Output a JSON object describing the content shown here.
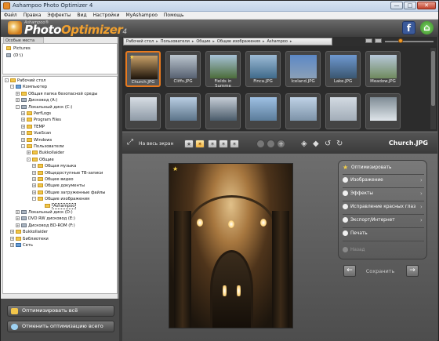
{
  "window": {
    "title": "Ashampoo Photo Optimizer 4",
    "controls": [
      "—",
      "□",
      "✕"
    ]
  },
  "menu": [
    "Файл",
    "Правка",
    "Эффекты",
    "Вид",
    "Настройки",
    "MyAshampoo",
    "Помощь"
  ],
  "header": {
    "logo_small": "Ashampoo®",
    "logo_main_a": "Photo",
    "logo_main_b": "Optimizer",
    "logo_version": "4",
    "icons": [
      "facebook-icon",
      "home-icon"
    ]
  },
  "favorites": {
    "tab_label": "Особые места",
    "items": [
      "Pictures",
      "(D:\\)"
    ]
  },
  "tree": [
    {
      "label": "Рабочий стол",
      "indent": 0,
      "icon": "folder",
      "pm": "-"
    },
    {
      "label": "Компьютер",
      "indent": 1,
      "icon": "pc",
      "pm": "-"
    },
    {
      "label": "Общая папка безопасной среды",
      "indent": 2,
      "icon": "folder",
      "pm": "+"
    },
    {
      "label": "Дисковод (A:)",
      "indent": 2,
      "icon": "drive",
      "pm": "+"
    },
    {
      "label": "Локальный диск (C:)",
      "indent": 2,
      "icon": "drive",
      "pm": "-"
    },
    {
      "label": "PerfLogs",
      "indent": 3,
      "icon": "folder",
      "pm": "+"
    },
    {
      "label": "Program Files",
      "indent": 3,
      "icon": "folder",
      "pm": "+"
    },
    {
      "label": "TEMP",
      "indent": 3,
      "icon": "folder",
      "pm": "+"
    },
    {
      "label": "VueScan",
      "indent": 3,
      "icon": "folder",
      "pm": "+"
    },
    {
      "label": "Windows",
      "indent": 3,
      "icon": "folder",
      "pm": "+"
    },
    {
      "label": "Пользователи",
      "indent": 3,
      "icon": "folder",
      "pm": "-"
    },
    {
      "label": "Bukkollaider",
      "indent": 4,
      "icon": "folder",
      "pm": "+"
    },
    {
      "label": "Общие",
      "indent": 4,
      "icon": "folder",
      "pm": "-"
    },
    {
      "label": "Общая музыка",
      "indent": 5,
      "icon": "folder",
      "pm": "+"
    },
    {
      "label": "Общедоступные ТВ-записи",
      "indent": 5,
      "icon": "folder",
      "pm": "+"
    },
    {
      "label": "Общее видео",
      "indent": 5,
      "icon": "folder",
      "pm": "+"
    },
    {
      "label": "Общие документы",
      "indent": 5,
      "icon": "folder",
      "pm": "+"
    },
    {
      "label": "Общие загруженные файлы",
      "indent": 5,
      "icon": "folder",
      "pm": "+"
    },
    {
      "label": "Общие изображения",
      "indent": 5,
      "icon": "folder",
      "pm": "-"
    },
    {
      "label": "Ashampoo",
      "indent": 6,
      "icon": "folder",
      "pm": "",
      "selected": true
    },
    {
      "label": "Локальный диск (D:)",
      "indent": 2,
      "icon": "drive",
      "pm": "+"
    },
    {
      "label": "DVD RW дисковод (E:)",
      "indent": 2,
      "icon": "drive",
      "pm": "+"
    },
    {
      "label": "Дисковод BD-ROM (F:)",
      "indent": 2,
      "icon": "drive",
      "pm": "+"
    },
    {
      "label": "Bukkollaider",
      "indent": 1,
      "icon": "folder",
      "pm": "+"
    },
    {
      "label": "Библиотеки",
      "indent": 1,
      "icon": "folder",
      "pm": "+"
    },
    {
      "label": "Сеть",
      "indent": 1,
      "icon": "pc",
      "pm": "+"
    }
  ],
  "left_buttons": {
    "optimize_all": "Оптимизировать всё",
    "undo_all": "Отменить оптимизацию всего"
  },
  "breadcrumb": [
    "Рабочий стол",
    "Пользователи",
    "Общие",
    "Общие изображения",
    "Ashampoo"
  ],
  "zoom_level": 0.3,
  "thumbnails": [
    {
      "name": "Church.JPG",
      "selected": true,
      "starred": true,
      "c1": "#c9a168",
      "c2": "#1d140b"
    },
    {
      "name": "Cliffs.JPG",
      "c1": "#bcc6cf",
      "c2": "#566070"
    },
    {
      "name": "Fields in Summe",
      "c1": "#a7c2d8",
      "c2": "#4b6c3a"
    },
    {
      "name": "Finca.JPG",
      "c1": "#9dbbd6",
      "c2": "#3f6a8a"
    },
    {
      "name": "Iceland.JPG",
      "c1": "#5c88c6",
      "c2": "#8aa0b8"
    },
    {
      "name": "Lake.JPG",
      "c1": "#6f99d1",
      "c2": "#3a5670"
    },
    {
      "name": "Meadow.JPG",
      "c1": "#b7c8da",
      "c2": "#6f8a5e"
    },
    {
      "name": "",
      "c1": "#d7dde4",
      "c2": "#8e9aa6"
    },
    {
      "name": "",
      "c1": "#b9cde2",
      "c2": "#5b7389"
    },
    {
      "name": "",
      "c1": "#c6cdd6",
      "c2": "#4a5b6a"
    },
    {
      "name": "",
      "c1": "#9ec0e3",
      "c2": "#5b7c9a"
    },
    {
      "name": "",
      "c1": "#bfd2e6",
      "c2": "#7d93a8"
    },
    {
      "name": "",
      "c1": "#d3dae2",
      "c2": "#a2adb8"
    },
    {
      "name": "",
      "c1": "#7f8c95",
      "c2": "#dfe5ea"
    }
  ],
  "toolbar": {
    "fullscreen": "На весь экран",
    "filename": "Church.JPG"
  },
  "actions": {
    "optimize": "Оптимизировать",
    "image": "Изображение",
    "effects": "Эффекты",
    "redeye": "Исправление красных глаз",
    "export": "Экспорт/Интернет",
    "print": "Печать",
    "undo": "Назад",
    "save": "Сохранить"
  },
  "colors": {
    "accent": "#e97a1e",
    "star": "#f4d04a"
  }
}
